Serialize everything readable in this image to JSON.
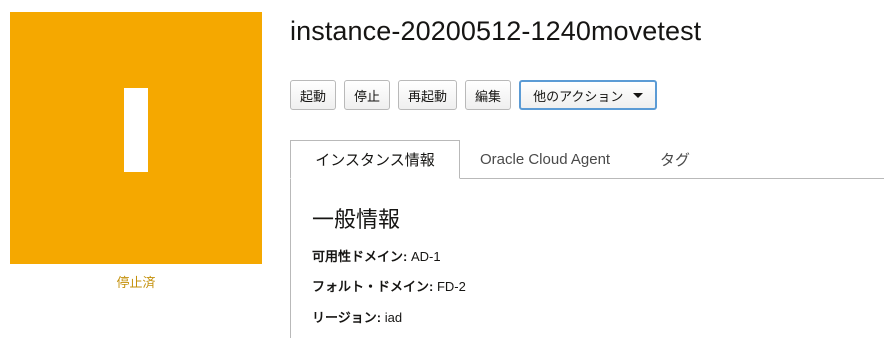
{
  "instance": {
    "tile_letter": "I",
    "status": "停止済",
    "name": "instance-20200512-1240movetest"
  },
  "toolbar": {
    "start": "起動",
    "stop": "停止",
    "reboot": "再起動",
    "edit": "編集",
    "more_actions": "他のアクション"
  },
  "tabs": [
    {
      "label": "インスタンス情報",
      "active": true
    },
    {
      "label": "Oracle Cloud Agent",
      "active": false
    },
    {
      "label": "タグ",
      "active": false
    }
  ],
  "general_info": {
    "title": "一般情報",
    "fields": [
      {
        "label": "可用性ドメイン:",
        "value": "AD-1"
      },
      {
        "label": "フォルト・ドメイン:",
        "value": "FD-2"
      },
      {
        "label": "リージョン:",
        "value": "iad"
      }
    ]
  },
  "colors": {
    "tile": "#f5a800",
    "status_text": "#c4900a",
    "focus_border": "#5b9bd5"
  }
}
